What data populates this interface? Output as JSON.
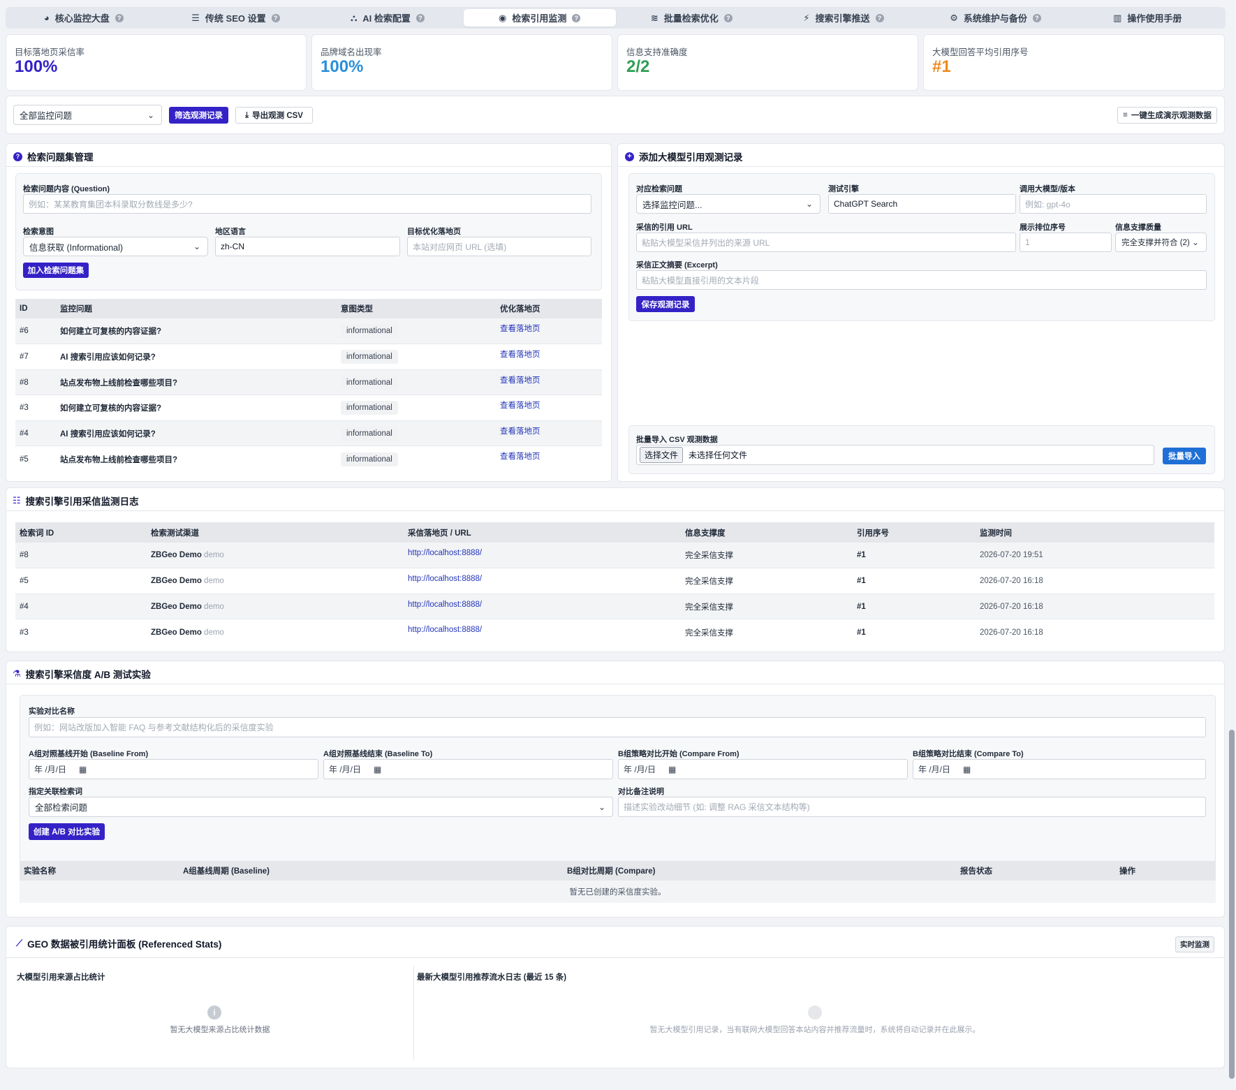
{
  "tabs": [
    {
      "label": "核心监控大盘",
      "icon": "gauge-icon"
    },
    {
      "label": "传统 SEO 设置",
      "icon": "sliders-icon"
    },
    {
      "label": "AI 检索配置",
      "icon": "network-icon"
    },
    {
      "label": "检索引用监测",
      "icon": "eye-icon",
      "active": true
    },
    {
      "label": "批量检索优化",
      "icon": "layers-icon"
    },
    {
      "label": "搜索引擎推送",
      "icon": "bolt-icon"
    },
    {
      "label": "系统维护与备份",
      "icon": "gears-icon"
    },
    {
      "label": "操作使用手册",
      "icon": "book-icon",
      "no_help": true
    }
  ],
  "stats": [
    {
      "label": "目标落地页采信率",
      "value": "100%",
      "color": "#3422c7"
    },
    {
      "label": "品牌域名出现率",
      "value": "100%",
      "color": "#2b8fd9"
    },
    {
      "label": "信息支持准确度",
      "value": "2/2",
      "color": "#2f9e55"
    },
    {
      "label": "大模型回答平均引用序号",
      "value": "#1",
      "color": "#f08a1c"
    }
  ],
  "toolbar": {
    "filter_select": "全部监控问题",
    "filter_button": "筛选观测记录",
    "export_button": "导出观测 CSV",
    "demo_button": "一键生成演示观测数据"
  },
  "questions": {
    "title": "检索问题集管理",
    "question_label": "检索问题内容 (Question)",
    "question_placeholder": "例如：某某教育集团本科录取分数线是多少?",
    "intent_label": "检索意图",
    "intent_value": "信息获取 (Informational)",
    "locale_label": "地区语言",
    "locale_value": "zh-CN",
    "landing_label": "目标优化落地页",
    "landing_placeholder": "本站对应网页 URL (选填)",
    "add_button": "加入检索问题集",
    "columns": [
      "ID",
      "监控问题",
      "意图类型",
      "优化落地页"
    ],
    "rows": [
      {
        "id": "#6",
        "q": "如何建立可复核的内容证据?",
        "intent": "informational",
        "link": "查看落地页"
      },
      {
        "id": "#7",
        "q": "AI 搜索引用应该如何记录?",
        "intent": "informational",
        "link": "查看落地页"
      },
      {
        "id": "#8",
        "q": "站点发布物上线前检查哪些项目?",
        "intent": "informational",
        "link": "查看落地页"
      },
      {
        "id": "#3",
        "q": "如何建立可复核的内容证据?",
        "intent": "informational",
        "link": "查看落地页"
      },
      {
        "id": "#4",
        "q": "AI 搜索引用应该如何记录?",
        "intent": "informational",
        "link": "查看落地页"
      },
      {
        "id": "#5",
        "q": "站点发布物上线前检查哪些项目?",
        "intent": "informational",
        "link": "查看落地页"
      }
    ]
  },
  "observation": {
    "title": "添加大模型引用观测记录",
    "question_label": "对应检索问题",
    "question_value": "选择监控问题...",
    "engine_label": "测试引擎",
    "engine_value": "ChatGPT Search",
    "model_label": "调用大模型/版本",
    "model_placeholder": "例如: gpt-4o",
    "url_label": "采信的引用 URL",
    "url_placeholder": "粘贴大模型采信并列出的来源 URL",
    "rank_label": "展示排位序号",
    "rank_placeholder": "1",
    "quality_label": "信息支撑质量",
    "quality_value": "完全支撑并符合 (2)",
    "excerpt_label": "采信正文摘要 (Excerpt)",
    "excerpt_placeholder": "粘贴大模型直接引用的文本片段",
    "save_button": "保存观测记录",
    "import_label": "批量导入 CSV 观测数据",
    "file_button": "选择文件",
    "file_status": "未选择任何文件",
    "import_button": "批量导入"
  },
  "log": {
    "title": "搜索引擎引用采信监测日志",
    "columns": [
      "检索词 ID",
      "检索测试渠道",
      "采信落地页 / URL",
      "信息支撑度",
      "引用序号",
      "监测时间"
    ],
    "rows": [
      {
        "id": "#8",
        "channel": "ZBGeo Demo",
        "tag": "demo",
        "url": "http://localhost:8888/",
        "support": "完全采信支撑",
        "rank": "#1",
        "time": "2026-07-20 19:51"
      },
      {
        "id": "#5",
        "channel": "ZBGeo Demo",
        "tag": "demo",
        "url": "http://localhost:8888/",
        "support": "完全采信支撑",
        "rank": "#1",
        "time": "2026-07-20 16:18"
      },
      {
        "id": "#4",
        "channel": "ZBGeo Demo",
        "tag": "demo",
        "url": "http://localhost:8888/",
        "support": "完全采信支撑",
        "rank": "#1",
        "time": "2026-07-20 16:18"
      },
      {
        "id": "#3",
        "channel": "ZBGeo Demo",
        "tag": "demo",
        "url": "http://localhost:8888/",
        "support": "完全采信支撑",
        "rank": "#1",
        "time": "2026-07-20 16:18"
      }
    ]
  },
  "ab": {
    "title": "搜索引擎采信度 A/B 测试实验",
    "name_label": "实验对比名称",
    "name_placeholder": "例如：网站改版加入智能 FAQ 与参考文献结构化后的采信度实验",
    "a_from_label": "A组对照基线开始 (Baseline From)",
    "a_to_label": "A组对照基线结束 (Baseline To)",
    "b_from_label": "B组策略对比开始 (Compare From)",
    "b_to_label": "B组策略对比结束 (Compare To)",
    "date_placeholder": "年 /月/日",
    "kw_label": "指定关联检索词",
    "kw_value": "全部检索问题",
    "note_label": "对比备注说明",
    "note_placeholder": "描述实验改动细节 (如: 调整 RAG 采信文本结构等)",
    "create_button": "创建 A/B 对比实验",
    "columns": [
      "实验名称",
      "A组基线周期 (Baseline)",
      "B组对比周期 (Compare)",
      "报告状态",
      "操作"
    ],
    "empty": "暂无已创建的采信度实验。"
  },
  "stats_panel": {
    "title": "GEO 数据被引用统计面板 (Referenced Stats)",
    "badge": "实时监测",
    "left_title": "大模型引用来源占比统计",
    "left_empty": "暂无大模型来源占比统计数据",
    "right_title": "最新大模型引用推荐流水日志 (最近 15 条)",
    "right_empty": "暂无大模型引用记录，当有联网大模型回答本站内容并推荐流量时，系统将自动记录并在此展示。"
  }
}
